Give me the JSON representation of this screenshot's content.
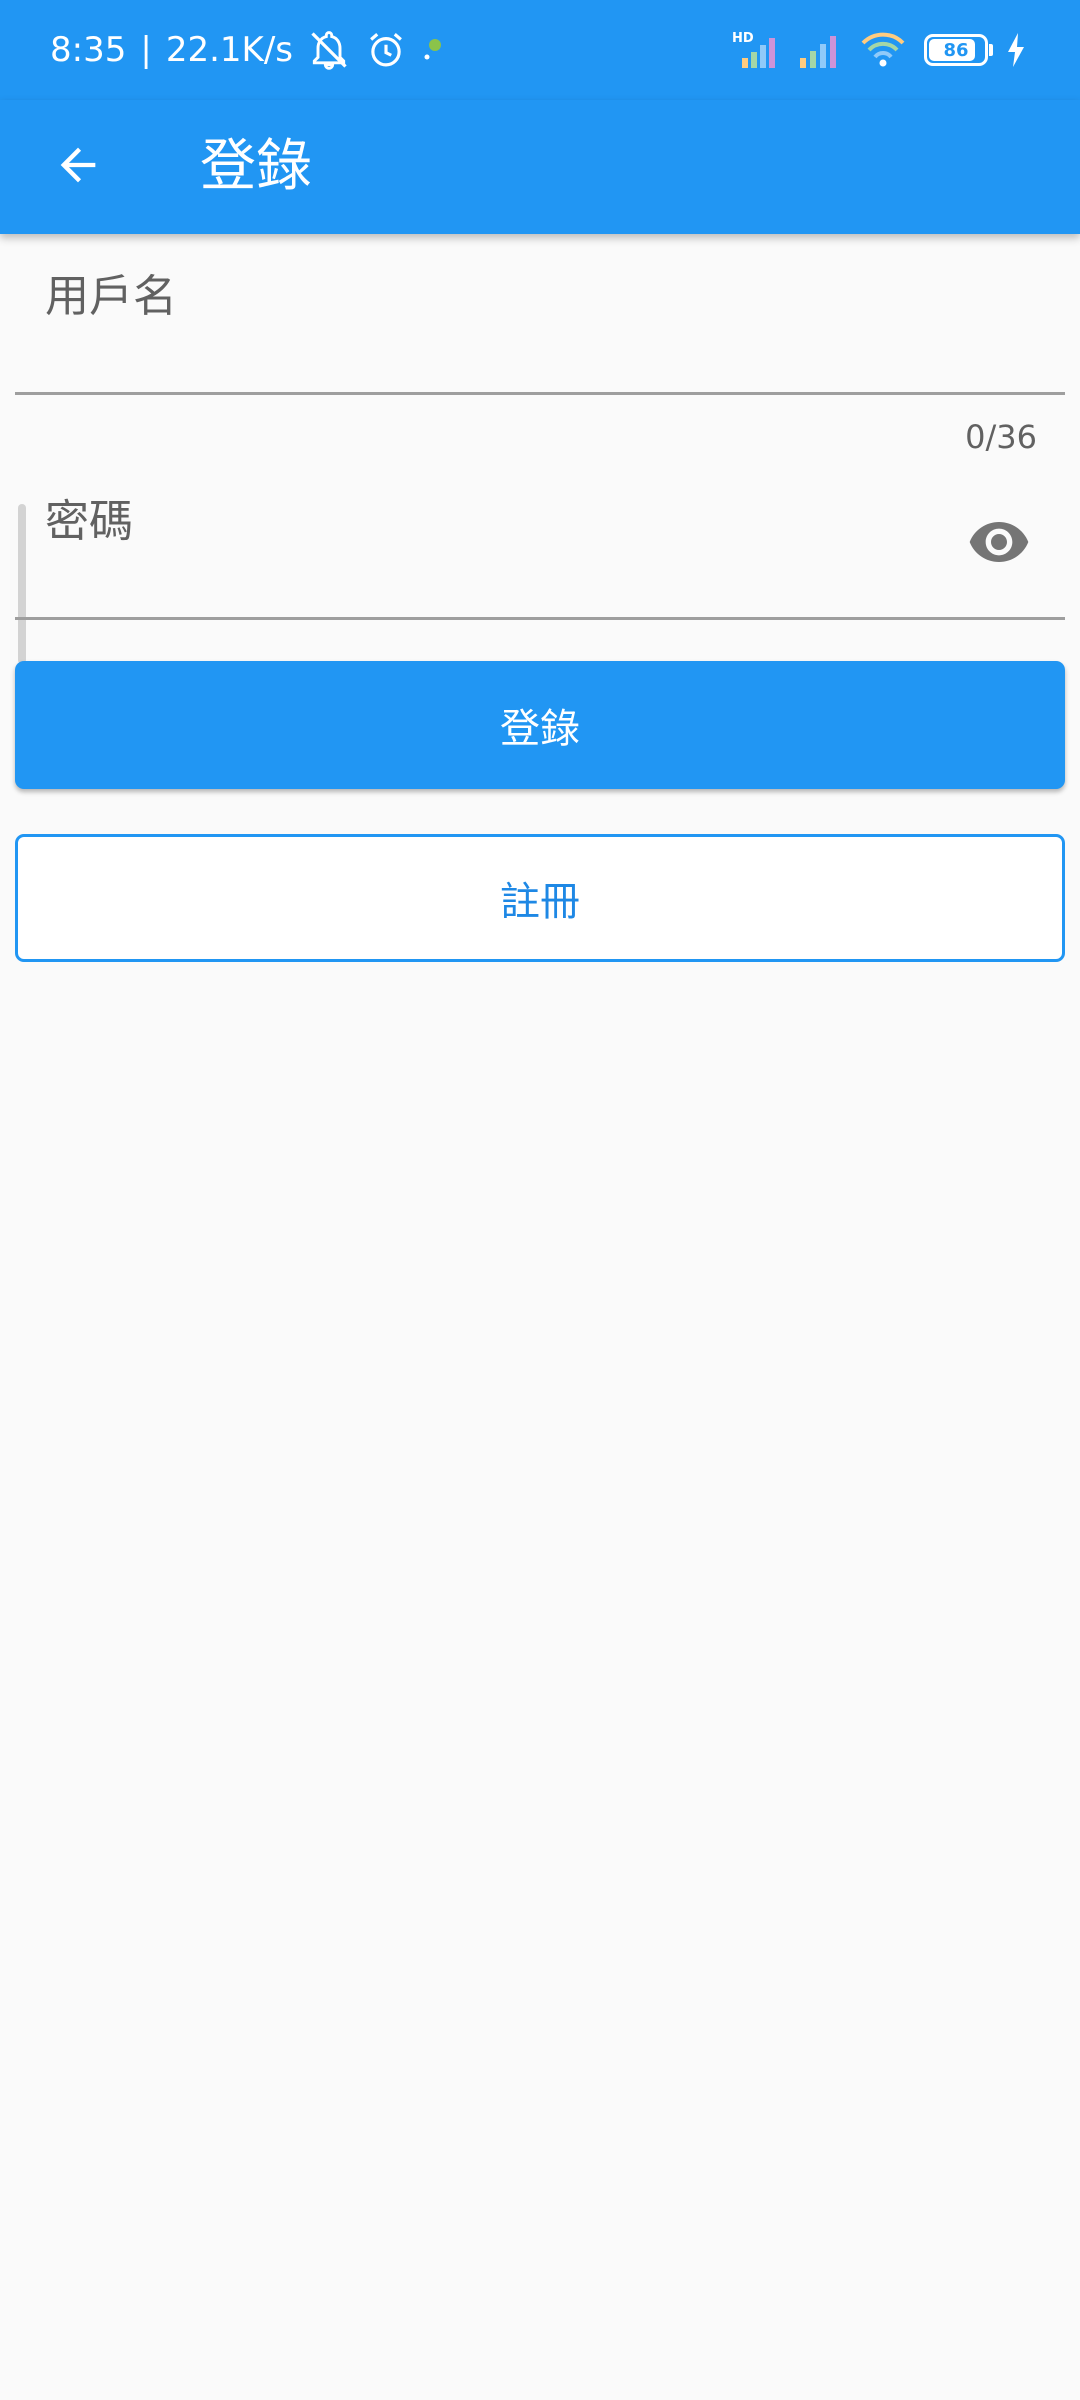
{
  "status_bar": {
    "time": "8:35",
    "separator": "|",
    "network_speed": "22.1K/s",
    "signal_badge": "HD",
    "battery_level": "86",
    "battery_fraction": 0.86,
    "icons": [
      "bell-off-icon",
      "alarm-icon",
      "notification-dot-icon",
      "hd-signal-icon",
      "signal-icon",
      "wifi-icon",
      "battery-icon",
      "charging-icon"
    ]
  },
  "app_bar": {
    "title": "登錄",
    "back_icon": "arrow-back-icon"
  },
  "form": {
    "username": {
      "placeholder": "用戶名",
      "value": "",
      "counter": "0/36"
    },
    "password": {
      "placeholder": "密碼",
      "value": "",
      "toggle_icon": "eye-icon"
    }
  },
  "buttons": {
    "login_label": "登錄",
    "register_label": "註冊"
  },
  "colors": {
    "primary": "#2196f3",
    "background": "#fafafa",
    "outline": "#2196f3",
    "underline": "#9e9e9e"
  }
}
